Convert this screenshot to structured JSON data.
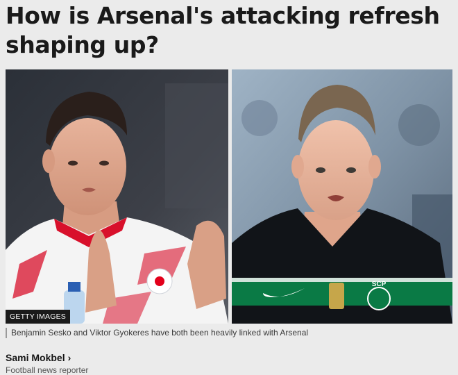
{
  "article": {
    "headline": "How is Arsenal's attacking refresh shaping up?",
    "image": {
      "credit": "GETTY IMAGES",
      "caption": "Benjamin Sesko and Viktor Gyokeres have both been heavily linked with Arsenal",
      "left_photo_icon": "player-photo-icon",
      "right_photo_icon": "player-photo-icon",
      "shirt_text": "SCP"
    },
    "author": {
      "name": "Sami Mokbel",
      "chevron": "›",
      "role": "Football news reporter"
    }
  },
  "colors": {
    "background": "#ebebeb",
    "text": "#141414",
    "credit_bg": "#1a1a1a",
    "leipzig_red": "#d8102b",
    "sporting_green": "#0a7a45"
  }
}
